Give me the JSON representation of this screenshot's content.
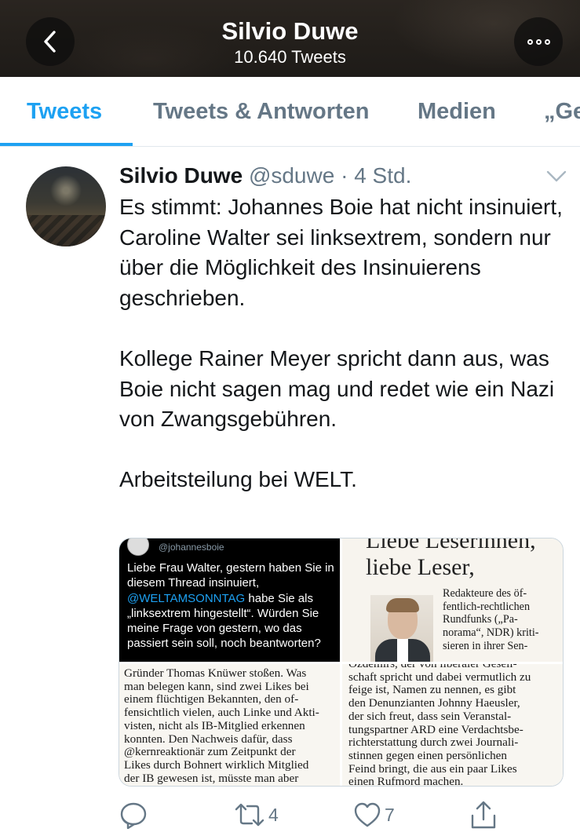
{
  "header": {
    "title": "Silvio Duwe",
    "subtitle": "10.640 Tweets"
  },
  "tabs": [
    {
      "label": "Tweets",
      "active": true
    },
    {
      "label": "Tweets & Antworten",
      "active": false
    },
    {
      "label": "Medien",
      "active": false
    },
    {
      "label": "„Ge",
      "active": false
    }
  ],
  "tweet": {
    "name": "Silvio Duwe",
    "handle": "@sduwe",
    "separator": "·",
    "time": "4 Std.",
    "paragraphs": [
      "Es stimmt: Johannes Boie hat nicht insinuiert, Caroline Walter sei linksextrem, sondern nur über die Möglichkeit des Insinuierens geschrieben.",
      "Kollege Rainer Meyer spricht dann aus, was Boie nicht sagen mag und redet wie ein Nazi von Zwangsgebühren.",
      "Arbeitsteilung bei WELT."
    ],
    "media": {
      "image1": {
        "handle": "@johannesboie",
        "text_before": "Liebe Frau Walter, gestern haben Sie in diesem Thread insinuiert, ",
        "mention": "@WELTAMSONNTAG",
        "text_after": " habe Sie als „linksextrem hingestellt“. Würden Sie meine Frage von gestern, wo das passiert sein soll, noch beantworten?"
      },
      "image2": {
        "headline_cut": "Liebe Leserinnen,",
        "headline": "liebe Leser,",
        "caption_lines": [
          "Redakteure des öf-",
          "fentlich-rechtlichen",
          "Rundfunks („Pa-",
          "norama“, NDR) kriti-",
          "sieren in ihrer Sen-"
        ]
      },
      "image3": {
        "lines": [
          "Gründer Thomas Knüwer stoßen. Was",
          "man belegen kann, sind zwei Likes bei",
          "einem flüchtigen Bekannten, den of-",
          "fensichtlich vielen, auch Linke und Akti-",
          "visten, nicht als IB-Mitglied erkennen",
          "konnten. Den Nachweis dafür, dass",
          "@kernreaktionär zum Zeitpunkt der",
          "Likes durch Bohnert wirklich Mitglied",
          "der IB gewesen ist, müsste man aber"
        ]
      },
      "image4": {
        "lines": [
          "Özdemirs, der von liberaler Gesell-",
          "schaft spricht und dabei vermutlich zu",
          "feige ist, Namen zu nennen, es gibt",
          "den Denunzianten Johnny Haeusler,",
          "der sich freut, dass sein Veranstal-",
          "tungspartner ARD eine Verdachtsbe-",
          "richterstattung durch zwei Journali-",
          "stinnen gegen einen persönlichen",
          "Feind bringt, die aus ein paar Likes",
          "einen Rufmord machen."
        ]
      }
    },
    "actions": {
      "reply_icon": "reply-icon",
      "retweet_icon": "retweet-icon",
      "retweet_count": "4",
      "like_icon": "heart-icon",
      "like_count": "7",
      "share_icon": "share-icon"
    }
  },
  "colors": {
    "accent": "#1da1f2",
    "secondary_text": "#657786",
    "text": "#14171a",
    "divider": "#e1e8ed"
  }
}
